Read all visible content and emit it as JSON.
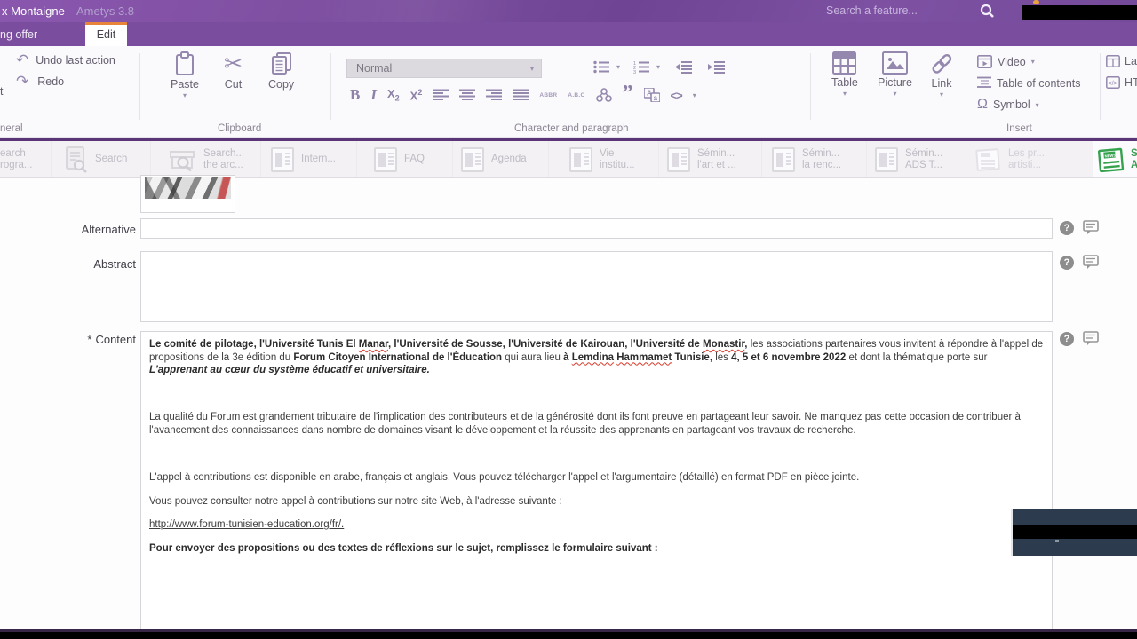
{
  "titlebar": {
    "app_title": "x Montaigne",
    "version": "Ametys 3.8",
    "search_placeholder": "Search a feature...",
    "accent_purple": "#7b4d9e",
    "accent_orange": "#e8833a"
  },
  "ribbon_tabs": {
    "left_tab_partial": "ng offer",
    "active_tab": "Edit"
  },
  "ribbon": {
    "general": {
      "label_partial": "neral",
      "undo_label": "Undo last action",
      "redo_label": "Redo",
      "edge_fragment": "t"
    },
    "clipboard": {
      "label": "Clipboard",
      "paste_label": "Paste",
      "cut_label": "Cut",
      "copy_label": "Copy"
    },
    "character": {
      "label": "Character and paragraph",
      "style_value": "Normal",
      "bold_glyph": "B",
      "italic_glyph": "I",
      "subscript_glyph": "X",
      "superscript_glyph": "X",
      "abbr_glyph": "ABBR",
      "abc_glyph": "A.B.C",
      "quote_glyph": "”",
      "code_glyph": "<>"
    },
    "insert": {
      "label": "Insert",
      "table_label": "Table",
      "picture_label": "Picture",
      "link_label": "Link",
      "video_label": "Video",
      "toc_label": "Table of contents",
      "symbol_label": "Symbol",
      "omega_glyph": "Ω",
      "layout_label_partial": "La",
      "html_label_partial": "HT"
    }
  },
  "content_tabs": [
    {
      "line1": "earch",
      "line2": "rogra..."
    },
    {
      "line1": "Search",
      "line2": ""
    },
    {
      "line1": "Search...",
      "line2": "the arc..."
    },
    {
      "line1": "Intern...",
      "line2": ""
    },
    {
      "line1": "FAQ",
      "line2": ""
    },
    {
      "line1": "Agenda",
      "line2": ""
    },
    {
      "line1": "Vie",
      "line2": "institu..."
    },
    {
      "line1": "Sémin...",
      "line2": "l'art et ..."
    },
    {
      "line1": "Sémin...",
      "line2": "la renc..."
    },
    {
      "line1": "Sémin...",
      "line2": "ADS T..."
    },
    {
      "line1": "Les pr...",
      "line2": "artisti..."
    },
    {
      "line1": "Sé",
      "line2": "AD"
    }
  ],
  "form": {
    "alternative_label": "Alternative",
    "abstract_label": "Abstract",
    "content_label": "Content",
    "required_marker": "*",
    "alternative_value": "",
    "abstract_value": ""
  },
  "editor": {
    "paragraphs": [
      {
        "runs": [
          {
            "t": "Le comité de pilotage, l'Université Tunis El ",
            "b": true
          },
          {
            "t": "Manar",
            "b": true,
            "sp": true
          },
          {
            "t": ", l'Université de Sousse, l'Université de Kairouan, l'Université de ",
            "b": true
          },
          {
            "t": "Monastir",
            "b": true,
            "sp": true
          },
          {
            "t": ",",
            "b": true
          },
          {
            "t": " les associations partenaires vous invitent à répondre à l'appel de propositions de la 3e édition du "
          },
          {
            "t": "Forum Citoyen International de l'Éducation",
            "b": true
          },
          {
            "t": " qui aura lieu "
          },
          {
            "t": "à ",
            "b": true
          },
          {
            "t": "Lemdina",
            "b": true,
            "sp": true
          },
          {
            "t": " ",
            "b": true
          },
          {
            "t": "Hammamet",
            "b": true,
            "sp": true
          },
          {
            "t": " Tunisie,",
            "b": true
          },
          {
            "t": " les "
          },
          {
            "t": "4, 5 et 6 novembre 2022",
            "b": true
          },
          {
            "t": " et dont la thématique porte sur "
          },
          {
            "t": "L'apprenant au cœur du système éducatif et universitaire.",
            "b": true,
            "i": true
          }
        ]
      },
      {
        "runs": []
      },
      {
        "runs": [
          {
            "t": "La qualité du Forum est grandement tributaire de l'implication des contributeurs et de la générosité dont ils font preuve en partageant leur savoir. Ne manquez pas cette occasion de contribuer à l'avancement des connaissances dans nombre de domaines visant le développement et la réussite des apprenants en partageant vos travaux de recherche."
          }
        ]
      },
      {
        "runs": []
      },
      {
        "runs": [
          {
            "t": "L'appel à contributions est disponible en arabe, français et anglais. Vous pouvez télécharger l'appel et l'argumentaire (détaillé) en format PDF en pièce jointe."
          }
        ]
      },
      {
        "runs": [
          {
            "t": "Vous pouvez consulter notre appel à contributions sur notre site Web, à l'adresse suivante :"
          }
        ]
      },
      {
        "runs": [
          {
            "t": "http://www.forum-tunisien-education.org/fr/.",
            "u": true
          }
        ]
      },
      {
        "runs": [
          {
            "t": "Pour envoyer des propositions ou des textes de réflexions sur le sujet, remplissez le formulaire suivant :",
            "b": true
          }
        ]
      }
    ]
  }
}
